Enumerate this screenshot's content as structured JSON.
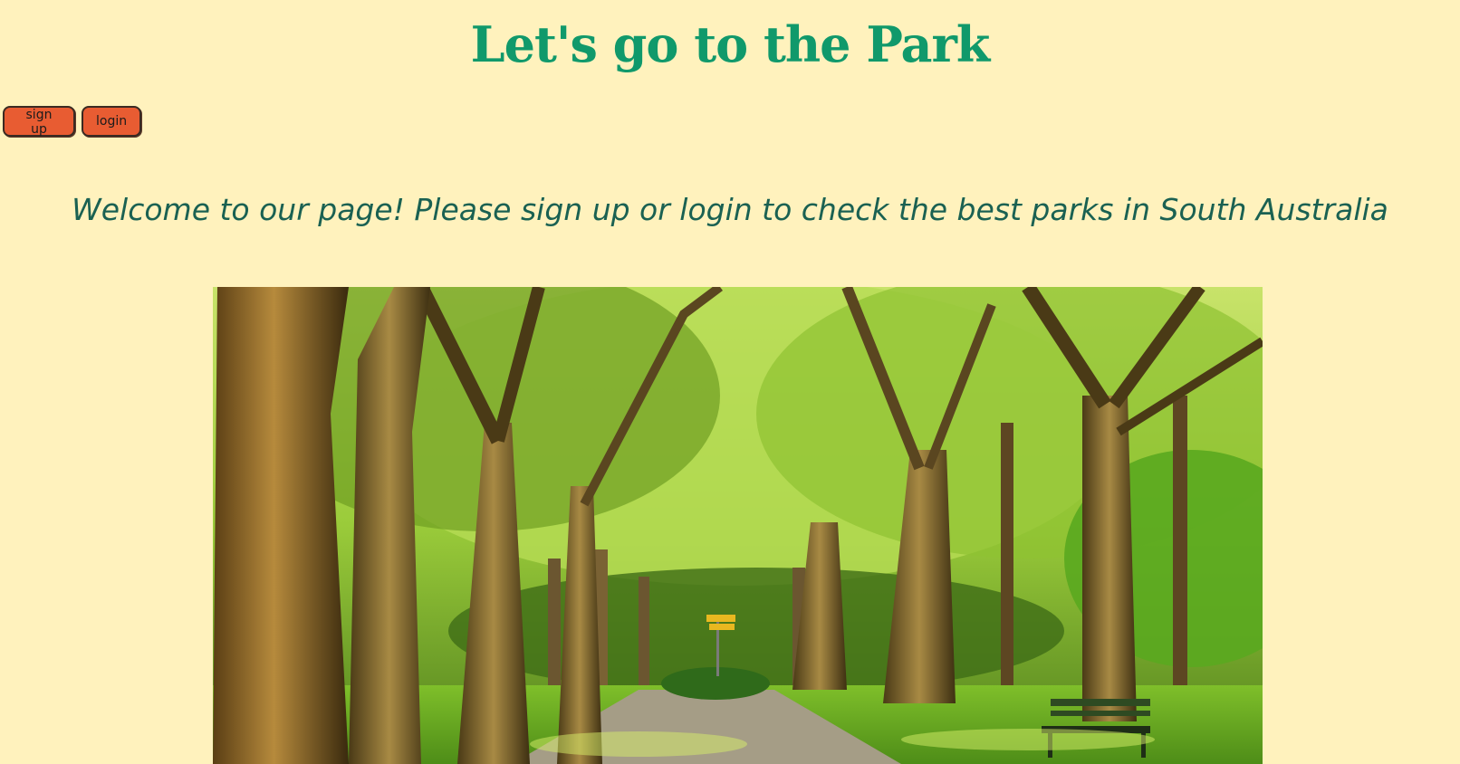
{
  "header": {
    "title": "Let's go to the Park"
  },
  "auth": {
    "signup_label": "sign up",
    "login_label": "login"
  },
  "main": {
    "welcome_text": "Welcome to our page! Please sign up or login to check the best parks in South Australia"
  },
  "colors": {
    "background": "#fff2bd",
    "title": "#10996b",
    "welcome": "#1a6152",
    "button": "#e85c32"
  }
}
